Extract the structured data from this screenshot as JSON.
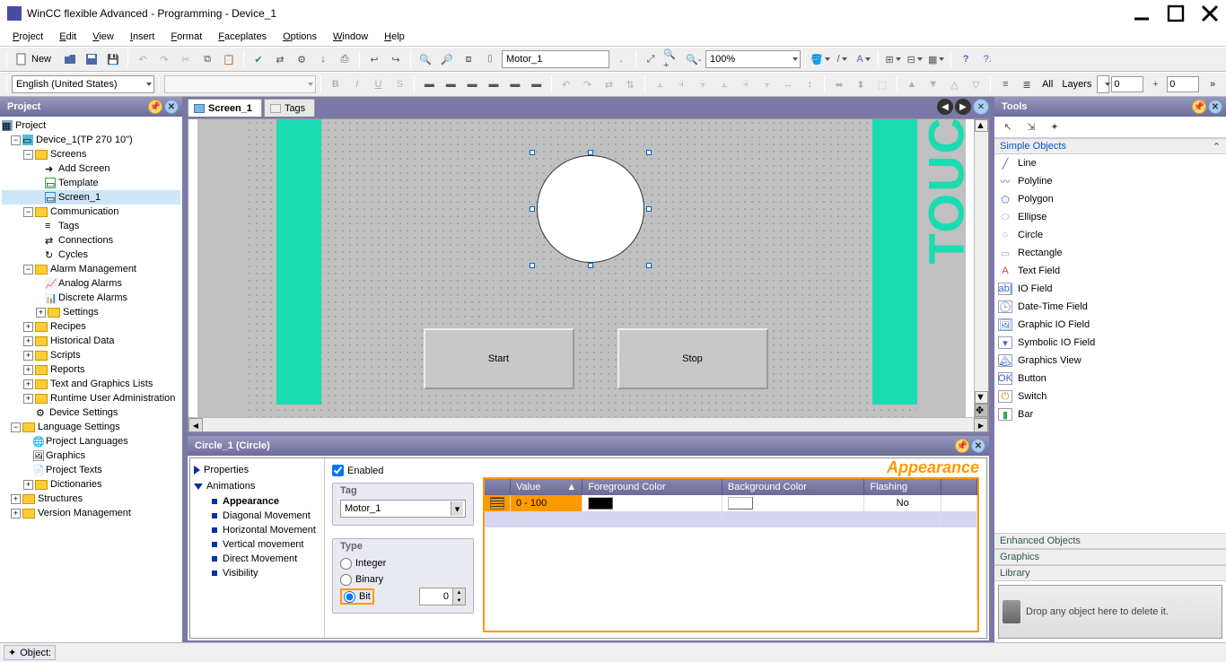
{
  "app": {
    "title": "WinCC flexible Advanced - Programming - Device_1"
  },
  "menu": [
    "Project",
    "Edit",
    "View",
    "Insert",
    "Format",
    "Faceplates",
    "Options",
    "Window",
    "Help"
  ],
  "toolbar1": {
    "new_label": "New",
    "object_name": "Motor_1",
    "zoom": "100%"
  },
  "toolbar2": {
    "language": "English (United States)",
    "layers_label": "Layers",
    "all_label": "All",
    "layer_a": "0",
    "layer_b": "0"
  },
  "project_panel": {
    "title": "Project"
  },
  "tree": {
    "root": "Project",
    "device": "Device_1(TP 270 10\")",
    "screens": "Screens",
    "add_screen": "Add Screen",
    "template": "Template",
    "screen1": "Screen_1",
    "communication": "Communication",
    "tags": "Tags",
    "connections": "Connections",
    "cycles": "Cycles",
    "alarm_mgmt": "Alarm Management",
    "analog_alarms": "Analog Alarms",
    "discrete_alarms": "Discrete Alarms",
    "settings": "Settings",
    "recipes": "Recipes",
    "historical": "Historical Data",
    "scripts": "Scripts",
    "reports": "Reports",
    "text_graphics": "Text and Graphics Lists",
    "runtime_admin": "Runtime User Administration",
    "device_settings": "Device Settings",
    "lang_settings": "Language Settings",
    "proj_lang": "Project Languages",
    "graphics": "Graphics",
    "proj_texts": "Project Texts",
    "dictionaries": "Dictionaries",
    "structures": "Structures",
    "version_mgmt": "Version Management"
  },
  "tabs": {
    "screen1": "Screen_1",
    "tags": "Tags"
  },
  "canvas": {
    "btn_start": "Start",
    "btn_stop": "Stop",
    "touch": "TOUC"
  },
  "props": {
    "header": "Circle_1 (Circle)",
    "nav": {
      "properties": "Properties",
      "animations": "Animations",
      "appearance": "Appearance",
      "diag": "Diagonal Movement",
      "horiz": "Horizontal Movement",
      "vert": "Vertical movement",
      "direct": "Direct Movement",
      "visibility": "Visibility"
    },
    "enabled_label": "Enabled",
    "page_title": "Appearance",
    "tag_legend": "Tag",
    "tag_value": "Motor_1",
    "type_legend": "Type",
    "type_integer": "Integer",
    "type_binary": "Binary",
    "type_bit": "Bit",
    "bit_value": "0",
    "cols": {
      "value": "Value",
      "fg": "Foreground Color",
      "bg": "Background Color",
      "flash": "Flashing"
    },
    "row1": {
      "value": "0 - 100",
      "flashing": "No"
    }
  },
  "tools": {
    "title": "Tools",
    "simple_objects": "Simple Objects",
    "items": [
      "Line",
      "Polyline",
      "Polygon",
      "Ellipse",
      "Circle",
      "Rectangle",
      "Text Field",
      "IO Field",
      "Date-Time Field",
      "Graphic IO Field",
      "Symbolic IO Field",
      "Graphics View",
      "Button",
      "Switch",
      "Bar"
    ],
    "enhanced": "Enhanced Objects",
    "graphics": "Graphics",
    "library": "Library",
    "drop_hint": "Drop any object here to delete it."
  },
  "status": {
    "label": "Object:"
  }
}
